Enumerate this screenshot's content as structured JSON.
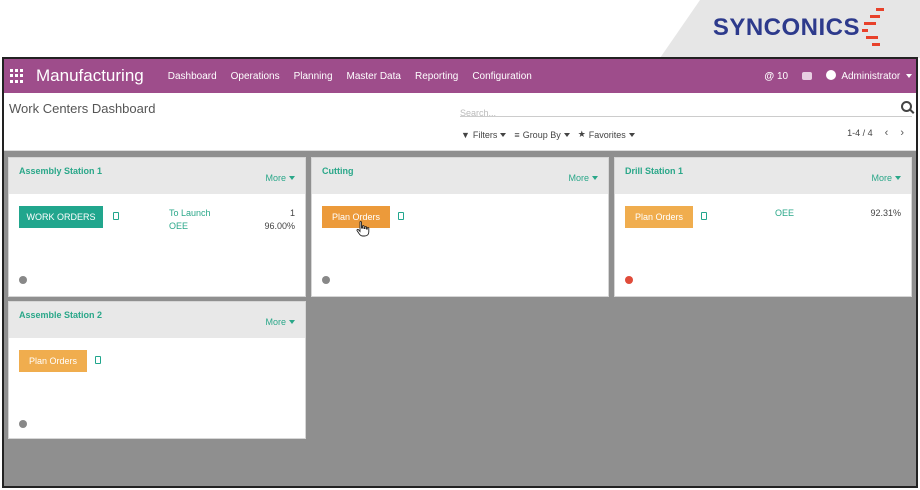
{
  "brand": {
    "logo_text": "SYNCONICS",
    "accent_color": "#e8412a",
    "text_color": "#2d3a8c"
  },
  "navbar": {
    "title": "Manufacturing",
    "menu": [
      "Dashboard",
      "Operations",
      "Planning",
      "Master Data",
      "Reporting",
      "Configuration"
    ],
    "notifications": "10",
    "user": "Administrator",
    "color": "#9e4d8b"
  },
  "control_panel": {
    "breadcrumb": "Work Centers Dashboard",
    "search_placeholder": "Search...",
    "filters": "Filters",
    "group_by": "Group By",
    "favorites": "Favorites",
    "pager": "1-4 / 4"
  },
  "cards": [
    {
      "title": "Assembly Station 1",
      "more": "More",
      "button": "WORK ORDERS",
      "stats": [
        {
          "label": "To Launch",
          "value": "1"
        },
        {
          "label": "OEE",
          "value": "96.00%"
        }
      ],
      "status": "grey"
    },
    {
      "title": "Cutting",
      "more": "More",
      "button": "Plan Orders",
      "stats": [],
      "status": "grey"
    },
    {
      "title": "Drill Station 1",
      "more": "More",
      "button": "Plan Orders",
      "stats": [
        {
          "label": "OEE",
          "value": "92.31%"
        }
      ],
      "status": "red"
    },
    {
      "title": "Assemble Station 2",
      "more": "More",
      "button": "Plan Orders",
      "stats": [],
      "status": "grey"
    }
  ],
  "colors": {
    "teal": "#21a68d",
    "orange": "#f0ad4e",
    "grey_dot": "#888888",
    "red_dot": "#e04b3a"
  }
}
